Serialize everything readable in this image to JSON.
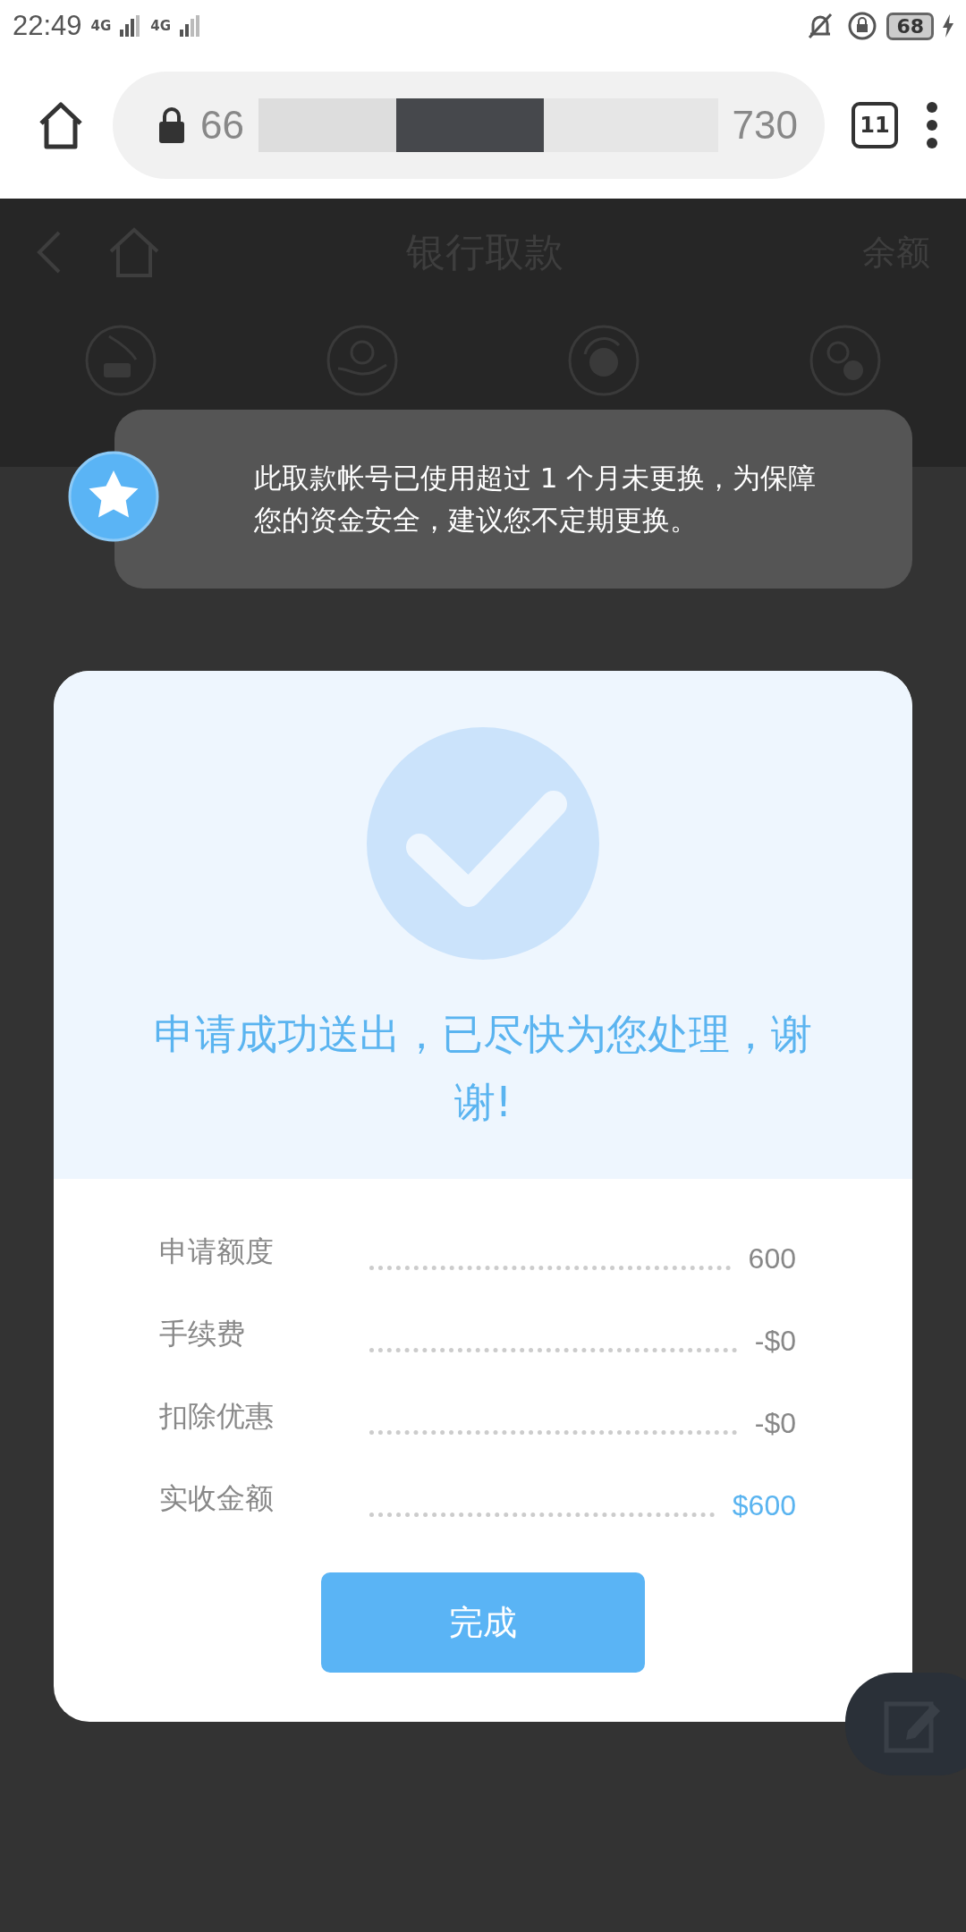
{
  "status_bar": {
    "time": "22:49",
    "network_1": "4G",
    "network_2": "4G",
    "battery": "68"
  },
  "browser": {
    "url_start": "66",
    "url_end": "730",
    "tab_count": "11"
  },
  "header": {
    "title": "银行取款",
    "balance_link": "余额"
  },
  "tiles": [
    {
      "kind": "card"
    },
    {
      "kind": "hand"
    },
    {
      "kind": "refresh"
    },
    {
      "kind": "exchange"
    }
  ],
  "toast": {
    "message": "此取款帐号已使用超过 1 个月未更换，为保障您的资金安全，建议您不定期更换。"
  },
  "dialog": {
    "title": "申请成功送出，已尽快为您处理，谢谢!",
    "rows": [
      {
        "label": "申请额度",
        "value": "600",
        "highlight": false
      },
      {
        "label": "手续费",
        "value": "-$0",
        "highlight": false
      },
      {
        "label": "扣除优惠",
        "value": "-$0",
        "highlight": false
      },
      {
        "label": "实收金额",
        "value": "$600",
        "highlight": true
      }
    ],
    "button": "完成"
  }
}
